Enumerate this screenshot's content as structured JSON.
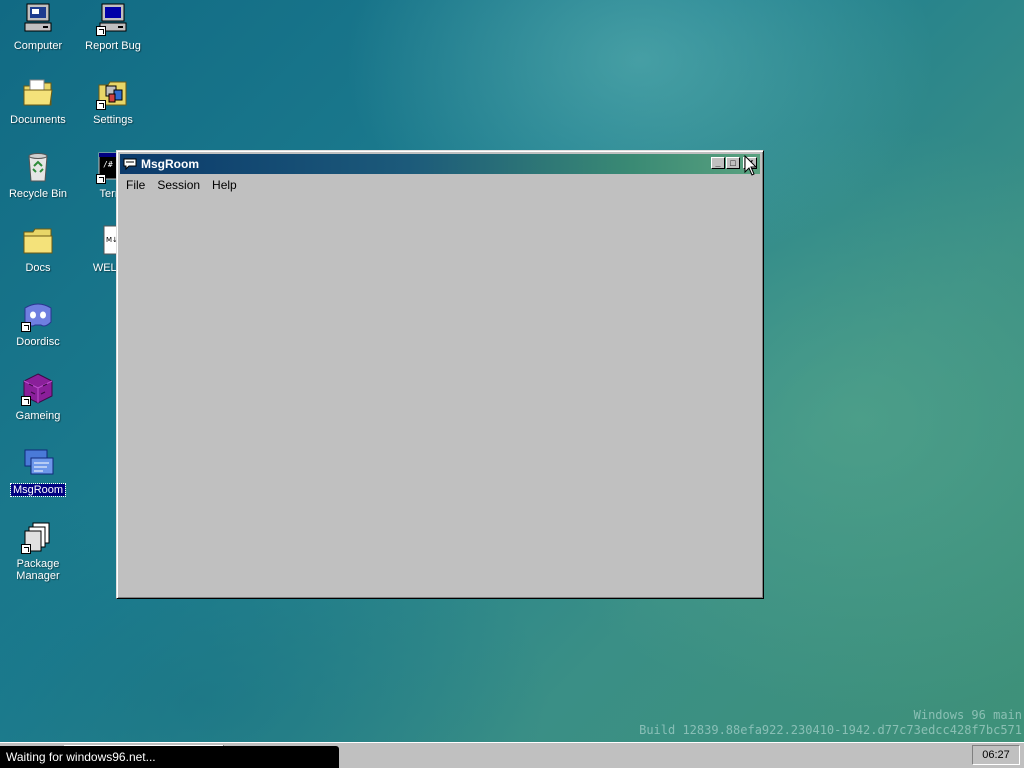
{
  "desktop": {
    "icons": [
      {
        "label": "Computer"
      },
      {
        "label": "Report Bug"
      },
      {
        "label": "Documents"
      },
      {
        "label": "Settings"
      },
      {
        "label": "Recycle Bin"
      },
      {
        "label": "Termi"
      },
      {
        "label": "Docs"
      },
      {
        "label": "WELCO"
      },
      {
        "label": "Doordisc"
      },
      {
        "label": "Gameing"
      },
      {
        "label": "MsgRoom"
      },
      {
        "label": "Package Manager"
      }
    ]
  },
  "window": {
    "title": "MsgRoom",
    "menu": [
      "File",
      "Session",
      "Help"
    ],
    "buttons": {
      "minimize": "_",
      "maximize": "□",
      "close": "✕"
    }
  },
  "watermark": {
    "line1": "Windows 96 main",
    "line2": "Build 12839.88efa922.230410-1942.d77c73edcc428f7bc571"
  },
  "taskbar": {
    "clock": "06:27"
  },
  "status": {
    "text": "Waiting for windows96.net..."
  },
  "colors": {
    "selection": "#000080",
    "face": "#c0c0c0",
    "title_start": "#0b3a6b",
    "title_end": "#5aa280"
  }
}
